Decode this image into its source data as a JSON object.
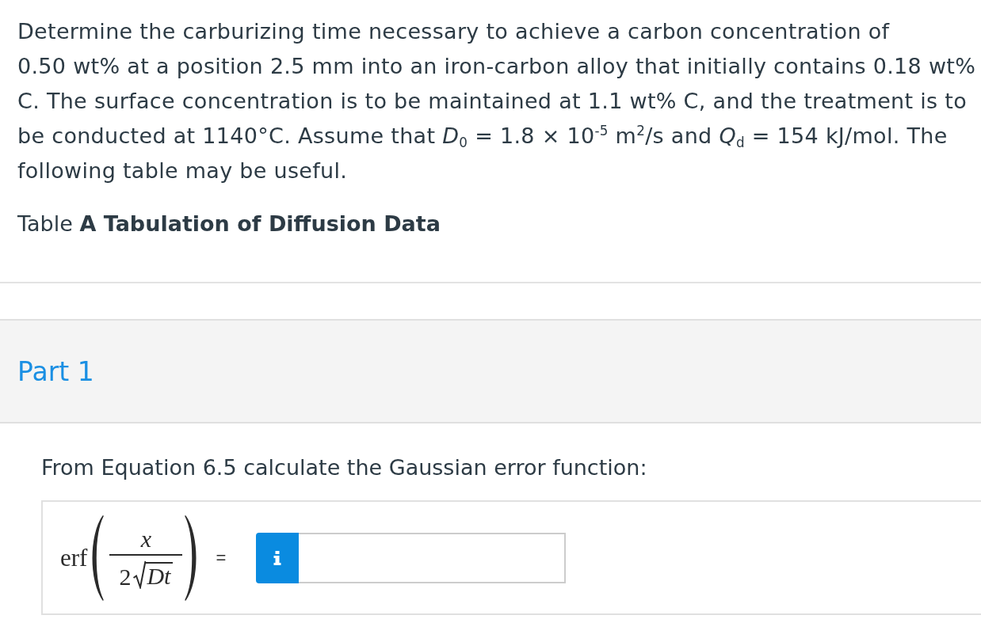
{
  "question": {
    "text": "Determine the carburizing time necessary to achieve a carbon concentration of 0.50 wt% at a position 2.5 mm into an iron-carbon alloy that initially contains 0.18 wt% C. The surface concentration is to be maintained at 1.1 wt% C, and the treatment is to be conducted at 1140°C. Assume that *D*$_{0}$ = 1.8 × 10$^{-5}$ m$^{2}$/s and *Q*$_{d}$ = 154 kJ/mol. The following table may be useful.",
    "table_caption": "Table **A Tabulation of Diffusion Data**"
  },
  "part": {
    "title": "Part 1",
    "prompt": "From Equation 6.5 calculate the Gaussian error function:",
    "equation": {
      "function": "erf",
      "numerator": "x",
      "coefficient": "2",
      "radicand": "Dt",
      "relation": "="
    }
  }
}
